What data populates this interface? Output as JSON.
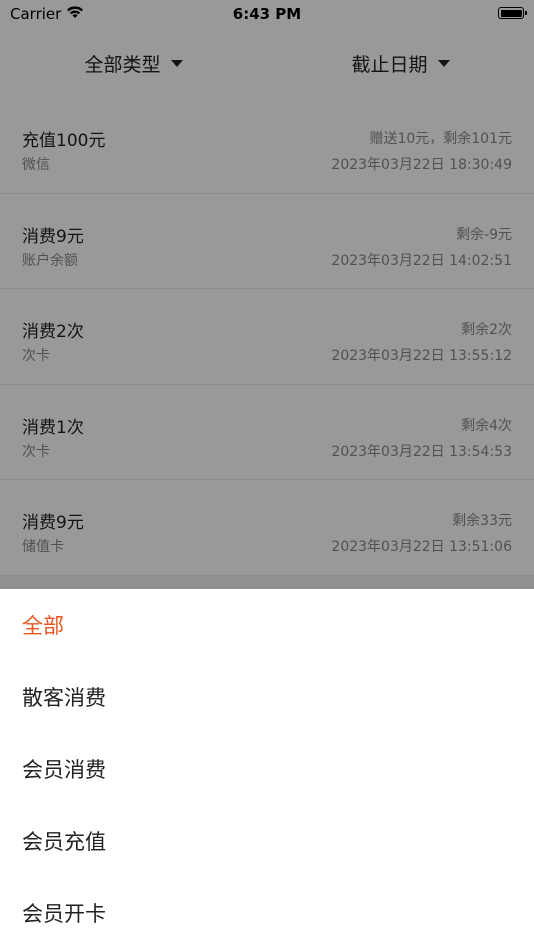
{
  "status_bar": {
    "carrier": "Carrier",
    "time": "6:43 PM",
    "wifi_icon": "wifi-icon",
    "battery_icon": "battery-full-icon"
  },
  "filters": {
    "type_label": "全部类型",
    "date_label": "截止日期",
    "caret_icon": "caret-down-icon"
  },
  "records": [
    {
      "title": "充值100元",
      "method": "微信",
      "note": "赠送10元，剩余101元",
      "datetime": "2023年03月22日 18:30:49"
    },
    {
      "title": "消费9元",
      "method": "账户余额",
      "note": "剩余-9元",
      "datetime": "2023年03月22日 14:02:51"
    },
    {
      "title": "消费2次",
      "method": "次卡",
      "note": "剩余2次",
      "datetime": "2023年03月22日 13:55:12"
    },
    {
      "title": "消费1次",
      "method": "次卡",
      "note": "剩余4次",
      "datetime": "2023年03月22日 13:54:53"
    },
    {
      "title": "消费9元",
      "method": "储值卡",
      "note": "剩余33元",
      "datetime": "2023年03月22日 13:51:06"
    }
  ],
  "sheet": {
    "selected_index": 0,
    "accent_color": "#e8541e",
    "options": [
      "全部",
      "散客消费",
      "会员消费",
      "会员充值",
      "会员开卡"
    ]
  }
}
